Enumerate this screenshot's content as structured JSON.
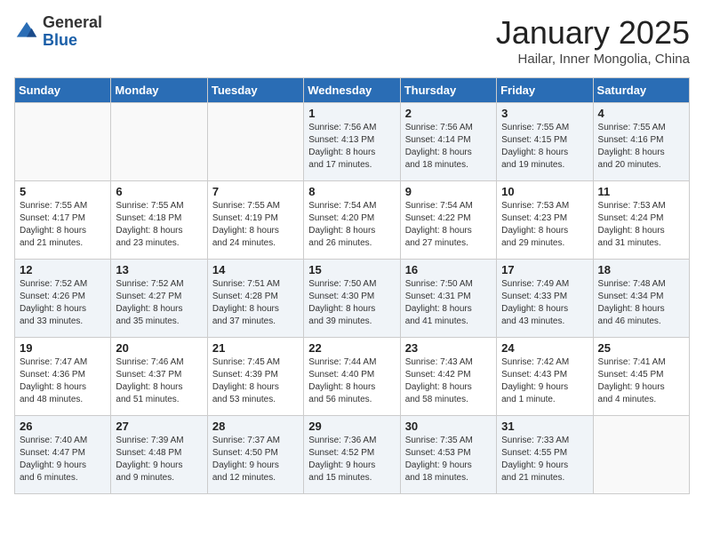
{
  "logo": {
    "general": "General",
    "blue": "Blue"
  },
  "title": "January 2025",
  "location": "Hailar, Inner Mongolia, China",
  "weekdays": [
    "Sunday",
    "Monday",
    "Tuesday",
    "Wednesday",
    "Thursday",
    "Friday",
    "Saturday"
  ],
  "weeks": [
    [
      {
        "day": "",
        "detail": ""
      },
      {
        "day": "",
        "detail": ""
      },
      {
        "day": "",
        "detail": ""
      },
      {
        "day": "1",
        "detail": "Sunrise: 7:56 AM\nSunset: 4:13 PM\nDaylight: 8 hours\nand 17 minutes."
      },
      {
        "day": "2",
        "detail": "Sunrise: 7:56 AM\nSunset: 4:14 PM\nDaylight: 8 hours\nand 18 minutes."
      },
      {
        "day": "3",
        "detail": "Sunrise: 7:55 AM\nSunset: 4:15 PM\nDaylight: 8 hours\nand 19 minutes."
      },
      {
        "day": "4",
        "detail": "Sunrise: 7:55 AM\nSunset: 4:16 PM\nDaylight: 8 hours\nand 20 minutes."
      }
    ],
    [
      {
        "day": "5",
        "detail": "Sunrise: 7:55 AM\nSunset: 4:17 PM\nDaylight: 8 hours\nand 21 minutes."
      },
      {
        "day": "6",
        "detail": "Sunrise: 7:55 AM\nSunset: 4:18 PM\nDaylight: 8 hours\nand 23 minutes."
      },
      {
        "day": "7",
        "detail": "Sunrise: 7:55 AM\nSunset: 4:19 PM\nDaylight: 8 hours\nand 24 minutes."
      },
      {
        "day": "8",
        "detail": "Sunrise: 7:54 AM\nSunset: 4:20 PM\nDaylight: 8 hours\nand 26 minutes."
      },
      {
        "day": "9",
        "detail": "Sunrise: 7:54 AM\nSunset: 4:22 PM\nDaylight: 8 hours\nand 27 minutes."
      },
      {
        "day": "10",
        "detail": "Sunrise: 7:53 AM\nSunset: 4:23 PM\nDaylight: 8 hours\nand 29 minutes."
      },
      {
        "day": "11",
        "detail": "Sunrise: 7:53 AM\nSunset: 4:24 PM\nDaylight: 8 hours\nand 31 minutes."
      }
    ],
    [
      {
        "day": "12",
        "detail": "Sunrise: 7:52 AM\nSunset: 4:26 PM\nDaylight: 8 hours\nand 33 minutes."
      },
      {
        "day": "13",
        "detail": "Sunrise: 7:52 AM\nSunset: 4:27 PM\nDaylight: 8 hours\nand 35 minutes."
      },
      {
        "day": "14",
        "detail": "Sunrise: 7:51 AM\nSunset: 4:28 PM\nDaylight: 8 hours\nand 37 minutes."
      },
      {
        "day": "15",
        "detail": "Sunrise: 7:50 AM\nSunset: 4:30 PM\nDaylight: 8 hours\nand 39 minutes."
      },
      {
        "day": "16",
        "detail": "Sunrise: 7:50 AM\nSunset: 4:31 PM\nDaylight: 8 hours\nand 41 minutes."
      },
      {
        "day": "17",
        "detail": "Sunrise: 7:49 AM\nSunset: 4:33 PM\nDaylight: 8 hours\nand 43 minutes."
      },
      {
        "day": "18",
        "detail": "Sunrise: 7:48 AM\nSunset: 4:34 PM\nDaylight: 8 hours\nand 46 minutes."
      }
    ],
    [
      {
        "day": "19",
        "detail": "Sunrise: 7:47 AM\nSunset: 4:36 PM\nDaylight: 8 hours\nand 48 minutes."
      },
      {
        "day": "20",
        "detail": "Sunrise: 7:46 AM\nSunset: 4:37 PM\nDaylight: 8 hours\nand 51 minutes."
      },
      {
        "day": "21",
        "detail": "Sunrise: 7:45 AM\nSunset: 4:39 PM\nDaylight: 8 hours\nand 53 minutes."
      },
      {
        "day": "22",
        "detail": "Sunrise: 7:44 AM\nSunset: 4:40 PM\nDaylight: 8 hours\nand 56 minutes."
      },
      {
        "day": "23",
        "detail": "Sunrise: 7:43 AM\nSunset: 4:42 PM\nDaylight: 8 hours\nand 58 minutes."
      },
      {
        "day": "24",
        "detail": "Sunrise: 7:42 AM\nSunset: 4:43 PM\nDaylight: 9 hours\nand 1 minute."
      },
      {
        "day": "25",
        "detail": "Sunrise: 7:41 AM\nSunset: 4:45 PM\nDaylight: 9 hours\nand 4 minutes."
      }
    ],
    [
      {
        "day": "26",
        "detail": "Sunrise: 7:40 AM\nSunset: 4:47 PM\nDaylight: 9 hours\nand 6 minutes."
      },
      {
        "day": "27",
        "detail": "Sunrise: 7:39 AM\nSunset: 4:48 PM\nDaylight: 9 hours\nand 9 minutes."
      },
      {
        "day": "28",
        "detail": "Sunrise: 7:37 AM\nSunset: 4:50 PM\nDaylight: 9 hours\nand 12 minutes."
      },
      {
        "day": "29",
        "detail": "Sunrise: 7:36 AM\nSunset: 4:52 PM\nDaylight: 9 hours\nand 15 minutes."
      },
      {
        "day": "30",
        "detail": "Sunrise: 7:35 AM\nSunset: 4:53 PM\nDaylight: 9 hours\nand 18 minutes."
      },
      {
        "day": "31",
        "detail": "Sunrise: 7:33 AM\nSunset: 4:55 PM\nDaylight: 9 hours\nand 21 minutes."
      },
      {
        "day": "",
        "detail": ""
      }
    ]
  ]
}
